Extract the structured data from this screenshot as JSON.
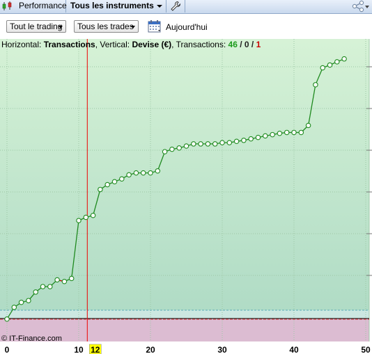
{
  "tabs": {
    "performance": "Performance",
    "instruments": "Tous les instruments"
  },
  "toolbar": {
    "trading_filter": "Tout le trading",
    "trades_filter": "Tous les trades",
    "today": "Aujourd'hui"
  },
  "info": {
    "horizontal_label": "Horizontal:",
    "horizontal_value": "Transactions",
    "vertical_label": ", Vertical:",
    "vertical_value": "Devise (€)",
    "transactions_label": ", Transactions:",
    "count_total": "46",
    "sep1": " / ",
    "count_flat": "0",
    "sep2": " / ",
    "count_loss": "1"
  },
  "copyright": "© IT-Finance.com",
  "colors": {
    "area_top": "#d4f0d4",
    "area_bottom": "#b0dcc6",
    "loss_area": "#dcbcd2",
    "line": "#1f8a1f",
    "loss_segment": "#cc0000",
    "cursor": "#ee0000",
    "cursor_label_bg": "#ffff00"
  },
  "chart_data": {
    "type": "line",
    "xlabel": "",
    "ylabel": "",
    "xlim": [
      0,
      50
    ],
    "x_ticks": [
      0,
      10,
      20,
      30,
      40,
      50
    ],
    "cursor_x": 11,
    "cursor_label": "12",
    "y_levels": [
      0,
      0.51,
      1.2,
      1.4,
      2.0,
      2.1,
      2.85,
      2.85,
      3.1,
      3.1,
      3.6,
      4.8,
      5.9,
      5.95,
      6.05,
      6.02,
      7.9,
      8.0,
      8.1,
      9.3,
      9.55,
      9.75,
      9.9,
      10.1,
      10.35,
      10.35,
      10.35,
      10.35,
      10.55,
      12.6,
      12.8,
      12.85,
      12.95,
      13.1,
      13.15,
      13.2,
      13.3,
      13.35,
      13.45,
      13.55,
      13.65,
      13.75,
      13.9,
      14.0,
      14.1,
      14.2,
      14.3,
      15.0,
      18.25,
      19.3,
      19.6,
      19.85,
      20.0
    ],
    "points": [
      [
        0,
        -0.04
      ],
      [
        1,
        0.88
      ],
      [
        2,
        1.27
      ],
      [
        3,
        1.41
      ],
      [
        4,
        2.08
      ],
      [
        5,
        2.51
      ],
      [
        6,
        2.51
      ],
      [
        7,
        3.04
      ],
      [
        8,
        2.91
      ],
      [
        9,
        3.15
      ],
      [
        10,
        7.7
      ],
      [
        11,
        7.95
      ],
      [
        12,
        8.1
      ],
      [
        13,
        10.14
      ],
      [
        14,
        10.52
      ],
      [
        15,
        10.75
      ],
      [
        16,
        10.97
      ],
      [
        17,
        11.29
      ],
      [
        18,
        11.44
      ],
      [
        19,
        11.44
      ],
      [
        20,
        11.44
      ],
      [
        21,
        11.6
      ],
      [
        22,
        13.11
      ],
      [
        23,
        13.3
      ],
      [
        24,
        13.4
      ],
      [
        25,
        13.55
      ],
      [
        26,
        13.72
      ],
      [
        27,
        13.72
      ],
      [
        28,
        13.72
      ],
      [
        29,
        13.72
      ],
      [
        30,
        13.82
      ],
      [
        31,
        13.82
      ],
      [
        32,
        13.92
      ],
      [
        33,
        14.0
      ],
      [
        34,
        14.12
      ],
      [
        35,
        14.23
      ],
      [
        36,
        14.35
      ],
      [
        37,
        14.45
      ],
      [
        38,
        14.55
      ],
      [
        39,
        14.62
      ],
      [
        40,
        14.62
      ],
      [
        41,
        14.62
      ],
      [
        42,
        15.17
      ],
      [
        43,
        18.37
      ],
      [
        44,
        19.7
      ],
      [
        45,
        19.92
      ],
      [
        46,
        20.17
      ],
      [
        47,
        20.4
      ]
    ],
    "loss_segment": [
      7,
      8
    ],
    "ylim": [
      -0.06,
      21.8
    ]
  }
}
